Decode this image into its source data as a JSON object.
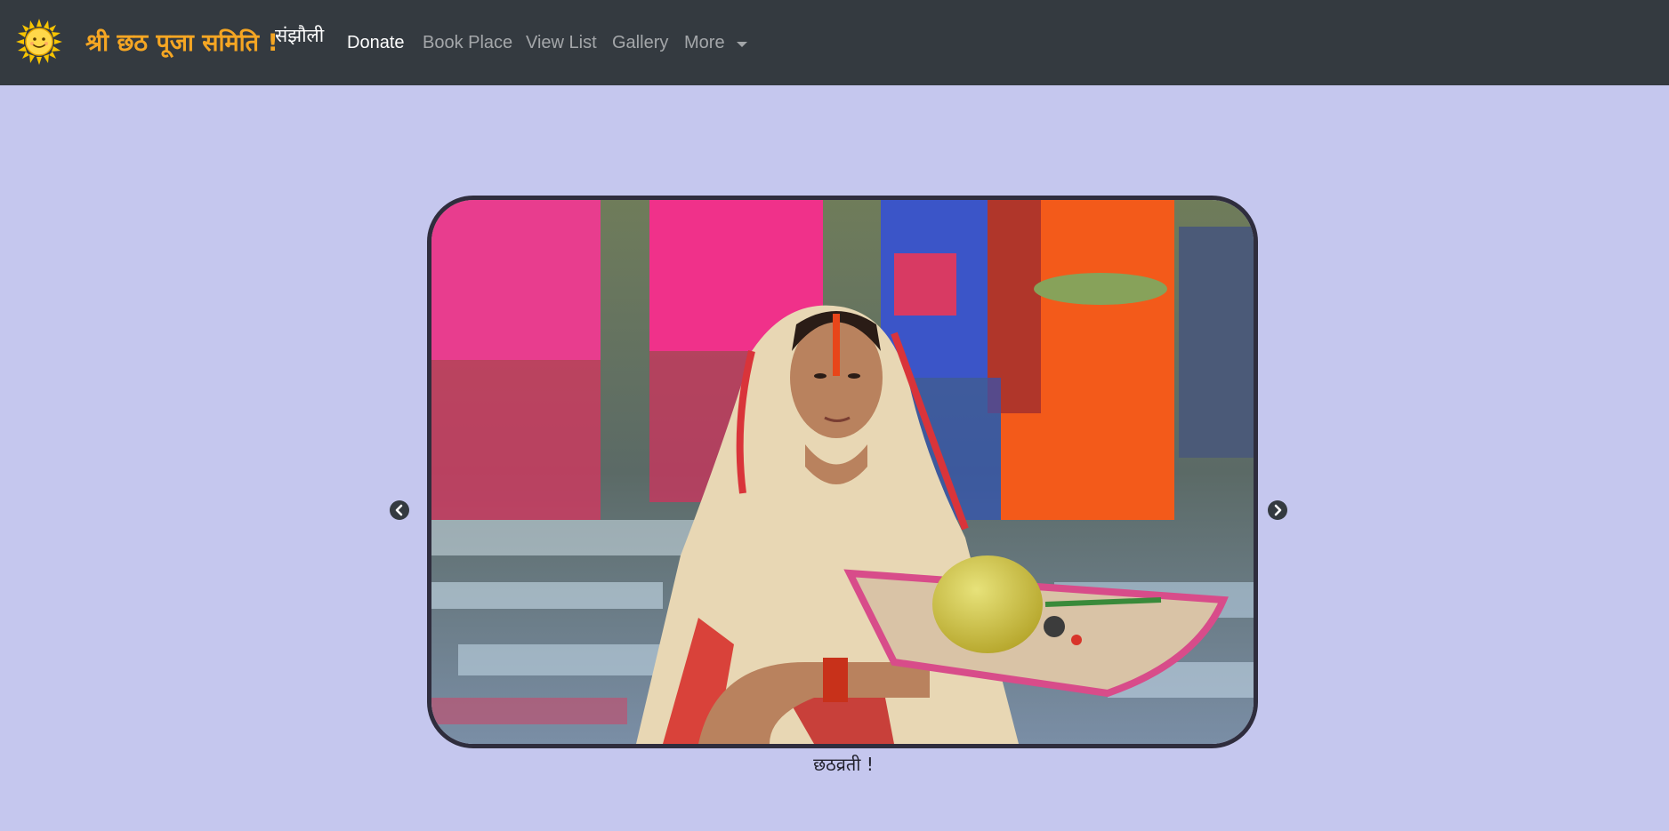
{
  "navbar": {
    "brand": "श्री छठ पूजा समिति !",
    "brand_sup": "संझौली",
    "links": [
      "Donate",
      "Book Place",
      "View List",
      "Gallery"
    ],
    "more_label": "More"
  },
  "carousel": {
    "caption": "छठव्रती !"
  },
  "colors": {
    "navbar_bg": "#343a40",
    "page_bg": "#c5c7ee",
    "brand": "#f5a623"
  },
  "icons": {
    "logo": "sun-logo-icon",
    "prev": "chevron-left-icon",
    "next": "chevron-right-icon",
    "dropdown": "caret-down-icon"
  }
}
